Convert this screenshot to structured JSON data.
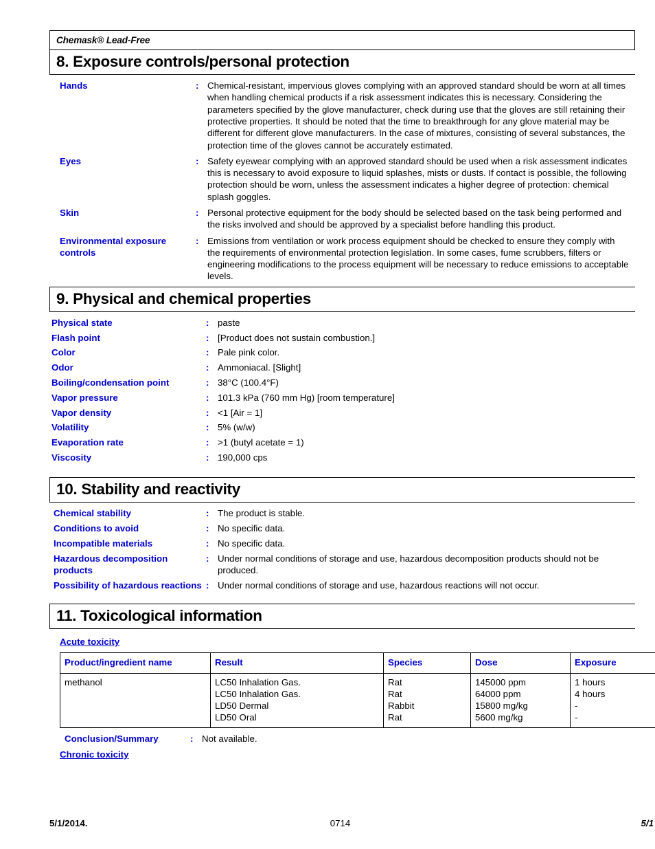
{
  "document": {
    "product_header": "Chemask® Lead-Free"
  },
  "section8": {
    "title": "8. Exposure controls/personal protection",
    "colon": ":",
    "rows": [
      {
        "label": "Hands",
        "value": "Chemical-resistant, impervious gloves complying with an approved standard should be worn at all times when handling chemical products if a risk assessment indicates this is necessary.  Considering the parameters specified by the glove manufacturer, check during use that the gloves are still retaining their protective properties.  It should be noted that the time to breakthrough for any glove material may be different for different glove manufacturers.  In the case of mixtures, consisting of several substances, the protection time of the gloves cannot be accurately estimated."
      },
      {
        "label": "Eyes",
        "value": "Safety eyewear complying with an approved standard should be used when a risk assessment indicates this is necessary to avoid exposure to liquid splashes, mists or dusts.  If contact is possible, the following protection should be worn, unless the assessment indicates a higher degree of protection:  chemical splash goggles."
      },
      {
        "label": "Skin",
        "value": "Personal protective equipment for the body should be selected based on the task being performed and the risks involved and should be approved by a specialist before handling this product."
      },
      {
        "label": "Environmental exposure controls",
        "value": "Emissions from ventilation or work process equipment should be checked to ensure they comply with the requirements of environmental protection legislation.  In some cases, fume scrubbers, filters or engineering modifications to the process equipment will be necessary to reduce emissions to acceptable levels."
      }
    ]
  },
  "section9": {
    "title": "9. Physical and chemical properties",
    "colon": ":",
    "rows": [
      {
        "label": "Physical state",
        "value": "paste"
      },
      {
        "label": "Flash point",
        "value": " [Product does not sustain combustion.]"
      },
      {
        "label": "Color",
        "value": "Pale pink  color."
      },
      {
        "label": "Odor",
        "value": "Ammoniacal. [Slight]"
      },
      {
        "label": "Boiling/condensation point",
        "value": "38°C (100.4°F)"
      },
      {
        "label": "Vapor pressure",
        "value": "101.3 kPa (760 mm Hg) [room temperature]"
      },
      {
        "label": "Vapor density",
        "value": "<1 [Air = 1]"
      },
      {
        "label": "Volatility",
        "value": "5% (w/w)"
      },
      {
        "label": "Evaporation rate",
        "value": ">1 (butyl acetate = 1)"
      },
      {
        "label": "Viscosity",
        "value": "190,000 cps"
      }
    ]
  },
  "section10": {
    "title": "10. Stability and reactivity",
    "colon": ":",
    "rows": [
      {
        "label": "Chemical stability",
        "value": "The product is stable."
      },
      {
        "label": "Conditions to avoid",
        "value": "No specific data."
      },
      {
        "label": "Incompatible materials",
        "value": "No specific data."
      },
      {
        "label": "Hazardous decomposition products",
        "value": "Under normal conditions of storage and use, hazardous decomposition products should not be produced."
      },
      {
        "label": "Possibility of hazardous reactions",
        "value": "Under normal conditions of storage and use, hazardous reactions will not occur."
      }
    ]
  },
  "section11": {
    "title": "11. Toxicological information",
    "acute_toxicity_heading": "Acute toxicity",
    "chronic_toxicity_heading": "Chronic toxicity",
    "colon": ":",
    "table": {
      "columns": [
        "Product/ingredient name",
        "Result",
        "Species",
        "Dose",
        "Exposure"
      ],
      "rows": [
        {
          "name": "methanol",
          "result": "LC50 Inhalation Gas.\nLC50 Inhalation Gas.\nLD50 Dermal\nLD50 Oral",
          "species": "Rat\nRat\nRabbit\nRat",
          "dose": "145000 ppm\n64000 ppm\n15800 mg/kg\n5600 mg/kg",
          "exposure": "1 hours\n4 hours\n-\n-"
        }
      ]
    },
    "conclusion": {
      "label": "Conclusion/Summary",
      "value": "Not available."
    }
  },
  "footer": {
    "date": "5/1/2014.",
    "code": "0714",
    "page": "5/1"
  }
}
